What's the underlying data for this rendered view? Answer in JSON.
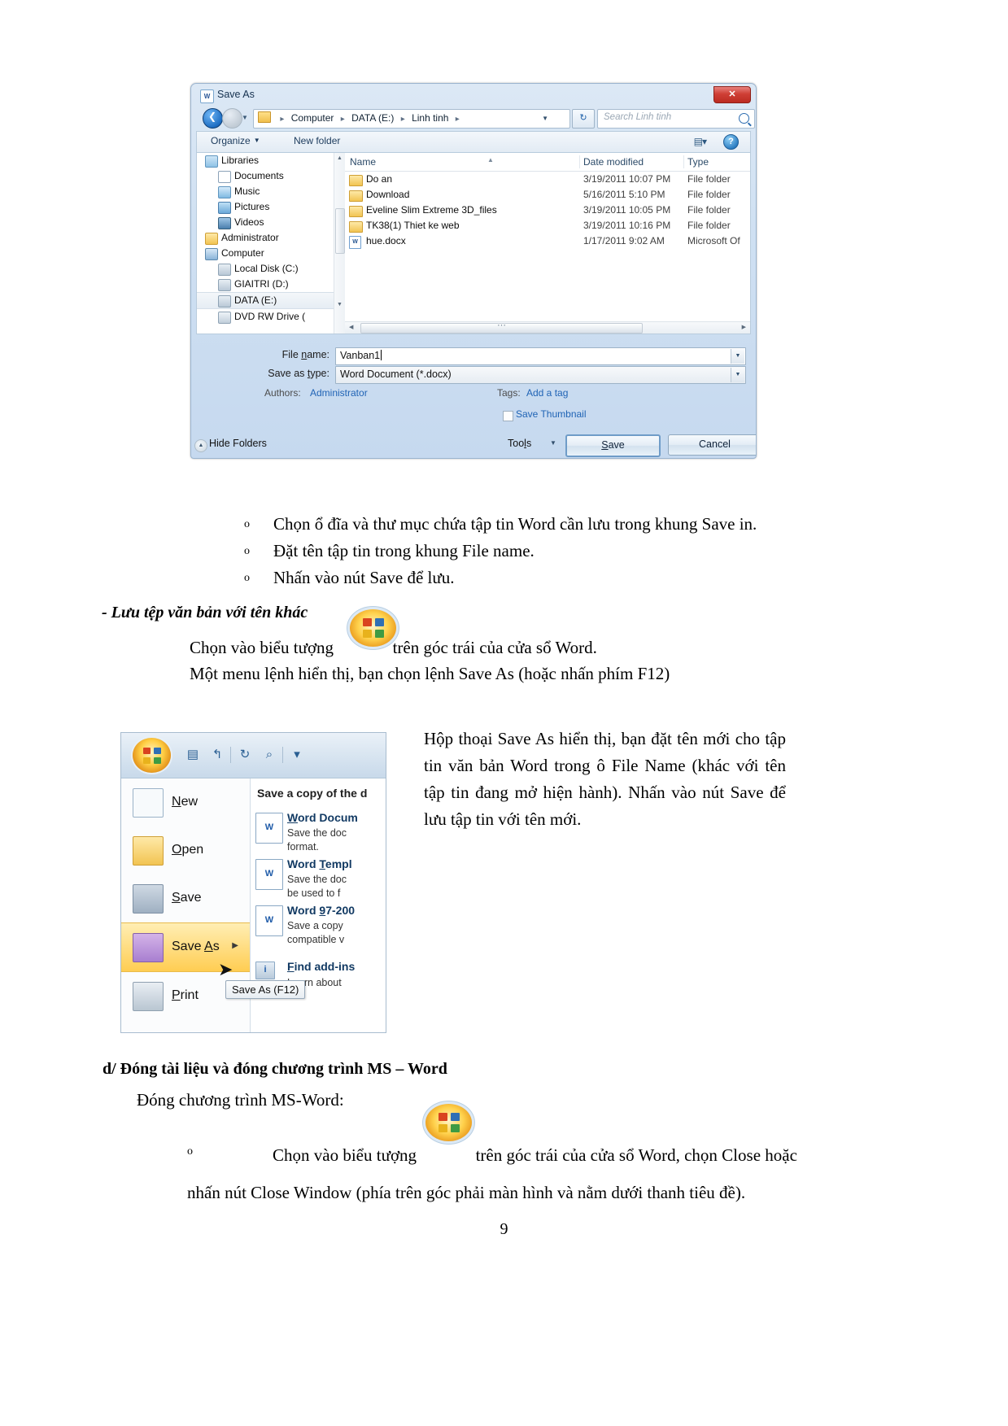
{
  "save_as_dialog": {
    "title": "Save As",
    "title_icon": "word-document-icon",
    "close_label": "✕",
    "breadcrumb": {
      "items": [
        "Computer",
        "DATA (E:)",
        "Linh tinh"
      ],
      "separator": "▸"
    },
    "search": {
      "placeholder": "Search Linh tinh"
    },
    "toolbar": {
      "organize": "Organize",
      "new_folder": "New folder",
      "caret": "▼",
      "help": "?"
    },
    "nav_pane": [
      {
        "label": "Libraries",
        "icon": "libraries-icon",
        "indent": 10,
        "selected": false
      },
      {
        "label": "Documents",
        "icon": "documents-icon",
        "indent": 26,
        "selected": false
      },
      {
        "label": "Music",
        "icon": "music-icon",
        "indent": 26,
        "selected": false
      },
      {
        "label": "Pictures",
        "icon": "pictures-icon",
        "indent": 26,
        "selected": false
      },
      {
        "label": "Videos",
        "icon": "videos-icon",
        "indent": 26,
        "selected": false
      },
      {
        "label": "Administrator",
        "icon": "user-folder-icon",
        "indent": 10,
        "selected": false
      },
      {
        "label": "Computer",
        "icon": "computer-icon",
        "indent": 10,
        "selected": false
      },
      {
        "label": "Local Disk (C:)",
        "icon": "drive-icon",
        "indent": 26,
        "selected": false
      },
      {
        "label": "GIAITRI (D:)",
        "icon": "drive-icon",
        "indent": 26,
        "selected": false
      },
      {
        "label": "DATA (E:)",
        "icon": "drive-icon",
        "indent": 26,
        "selected": true
      },
      {
        "label": "DVD RW Drive (",
        "icon": "dvd-drive-icon",
        "indent": 26,
        "selected": false
      }
    ],
    "columns": [
      "Name",
      "Date modified",
      "Type"
    ],
    "files": [
      {
        "name": "Do an",
        "date": "3/19/2011 10:07 PM",
        "type": "File folder",
        "icon": "folder-icon"
      },
      {
        "name": "Download",
        "date": "5/16/2011 5:10 PM",
        "type": "File folder",
        "icon": "folder-icon"
      },
      {
        "name": "Eveline Slim Extreme 3D_files",
        "date": "3/19/2011 10:05 PM",
        "type": "File folder",
        "icon": "folder-icon"
      },
      {
        "name": "TK38(1) Thiet ke web",
        "date": "3/19/2011 10:16 PM",
        "type": "File folder",
        "icon": "folder-icon"
      },
      {
        "name": "hue.docx",
        "date": "1/17/2011 9:02 AM",
        "type": "Microsoft Of",
        "icon": "word-document-icon"
      }
    ],
    "form": {
      "file_name_label": "File name:",
      "file_name_value": "Vanban1",
      "save_as_type_label": "Save as type:",
      "save_as_type_value": "Word Document (*.docx)",
      "authors_label": "Authors:",
      "authors_value": "Administrator",
      "tags_label": "Tags:",
      "tags_value": "Add a tag",
      "save_thumbnail_label": "Save Thumbnail"
    },
    "footer": {
      "hide_folders": "Hide Folders",
      "tools": "Tools",
      "save": "Save",
      "cancel": "Cancel"
    }
  },
  "body": {
    "bullets": [
      {
        "mark": "o",
        "text": "Chọn ổ đĩa và thư mục chứa tập tin Word cần lưu trong khung Save in."
      },
      {
        "mark": "o",
        "text": "Đặt tên tập tin trong khung File name."
      },
      {
        "mark": "o",
        "text": "Nhấn vào nút Save để lưu."
      }
    ],
    "section_heading": "- Lưu tệp văn bản với tên khác",
    "icon_line_before": "Chọn vào biểu tượng",
    "icon_line_after": "trên góc trái của cửa sổ Word.",
    "menu_line": "Một menu lệnh hiển thị, bạn chọn lệnh Save As (hoặc nhấn phím F12)",
    "right_paragraph": "Hộp thoại Save As hiển thị, bạn đặt tên mới cho tập tin văn bản Word trong ô File Name (khác với tên tập tin đang mở hiện hành). Nhấn vào nút Save để lưu tập tin với tên mới.",
    "section_heading_d": "d/ Đóng tài liệu và đóng chương trình MS – Word",
    "close_intro": "Đóng chương trình MS-Word:",
    "last_bullet": {
      "mark": "o",
      "line1_before": "Chọn vào biểu tượng",
      "line1_after": "trên góc trái của cửa sổ Word, chọn Close hoặc",
      "line2": "nhấn nút Close Window (phía trên góc phải màn hình và nằm dưới thanh tiêu đề)."
    },
    "page_number": "9"
  },
  "word_menu_shot": {
    "orb_icon": "office-orb-icon",
    "quick_access": [
      "save-icon",
      "undo-icon",
      "redo-icon",
      "print-preview-icon",
      "customize-icon"
    ],
    "left_items": [
      {
        "label": "New",
        "icon": "new-document-icon",
        "active": false,
        "arrow": ""
      },
      {
        "label": "Open",
        "icon": "open-folder-icon",
        "active": false,
        "arrow": ""
      },
      {
        "label": "Save",
        "icon": "save-disk-icon",
        "active": false,
        "arrow": ""
      },
      {
        "label": "Save As",
        "icon": "save-as-icon",
        "active": true,
        "arrow": "▶"
      },
      {
        "label": "Print",
        "icon": "print-icon",
        "active": false,
        "arrow": ""
      }
    ],
    "right_heading": "Save a copy of the d",
    "right_items": [
      {
        "title": "Word Docum",
        "desc_line1": "Save the doc",
        "desc_line2": "format.",
        "icon": "word-doc-icon"
      },
      {
        "title": "Word Templ",
        "desc_line1": "Save the doc",
        "desc_line2": "be used to f",
        "icon": "word-template-icon"
      },
      {
        "title": "Word 97-200",
        "desc_line1": "Save a copy",
        "desc_line2": "compatible v",
        "icon": "word-97-icon"
      },
      {
        "title": "Find add-ins",
        "desc_line1": "Learn about",
        "desc_line2": "",
        "icon": "find-addins-icon"
      }
    ],
    "tooltip": "Save As (F12)",
    "cursor_icon": "mouse-pointer-icon"
  }
}
